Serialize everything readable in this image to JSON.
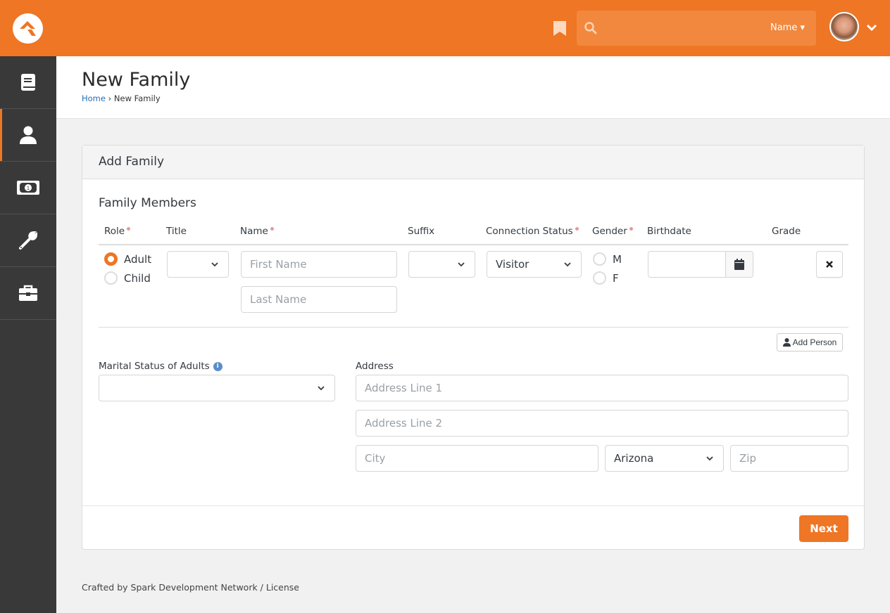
{
  "topbar": {
    "search_placeholder": "",
    "search_filter_label": "Name",
    "brand_color": "#ee7625"
  },
  "sidebar": {
    "items": [
      {
        "icon": "book-icon",
        "active": false
      },
      {
        "icon": "person-icon",
        "active": true
      },
      {
        "icon": "money-icon",
        "active": false
      },
      {
        "icon": "wrench-icon",
        "active": false
      },
      {
        "icon": "briefcase-icon",
        "active": false
      }
    ]
  },
  "header": {
    "title": "New Family",
    "breadcrumb": {
      "home": "Home",
      "separator": "›",
      "current": "New Family"
    }
  },
  "panel": {
    "title": "Add Family",
    "section_title": "Family Members",
    "columns": {
      "role": "Role",
      "title": "Title",
      "name": "Name",
      "suffix": "Suffix",
      "connection_status": "Connection Status",
      "gender": "Gender",
      "birthdate": "Birthdate",
      "grade": "Grade"
    },
    "member": {
      "role_options": [
        "Adult",
        "Child"
      ],
      "role_selected": "Adult",
      "title_value": "",
      "first_name_placeholder": "First Name",
      "last_name_placeholder": "Last Name",
      "suffix_value": "",
      "connection_status_value": "Visitor",
      "gender_options": [
        "M",
        "F"
      ],
      "birthdate_value": ""
    },
    "add_person_label": "Add Person",
    "marital_status_label": "Marital Status of Adults",
    "marital_status_value": "",
    "address_label": "Address",
    "address_line1_placeholder": "Address Line 1",
    "address_line2_placeholder": "Address Line 2",
    "city_placeholder": "City",
    "state_value": "Arizona",
    "zip_placeholder": "Zip",
    "next_label": "Next"
  },
  "footer": {
    "credits": "Crafted by Spark Development Network / License"
  }
}
